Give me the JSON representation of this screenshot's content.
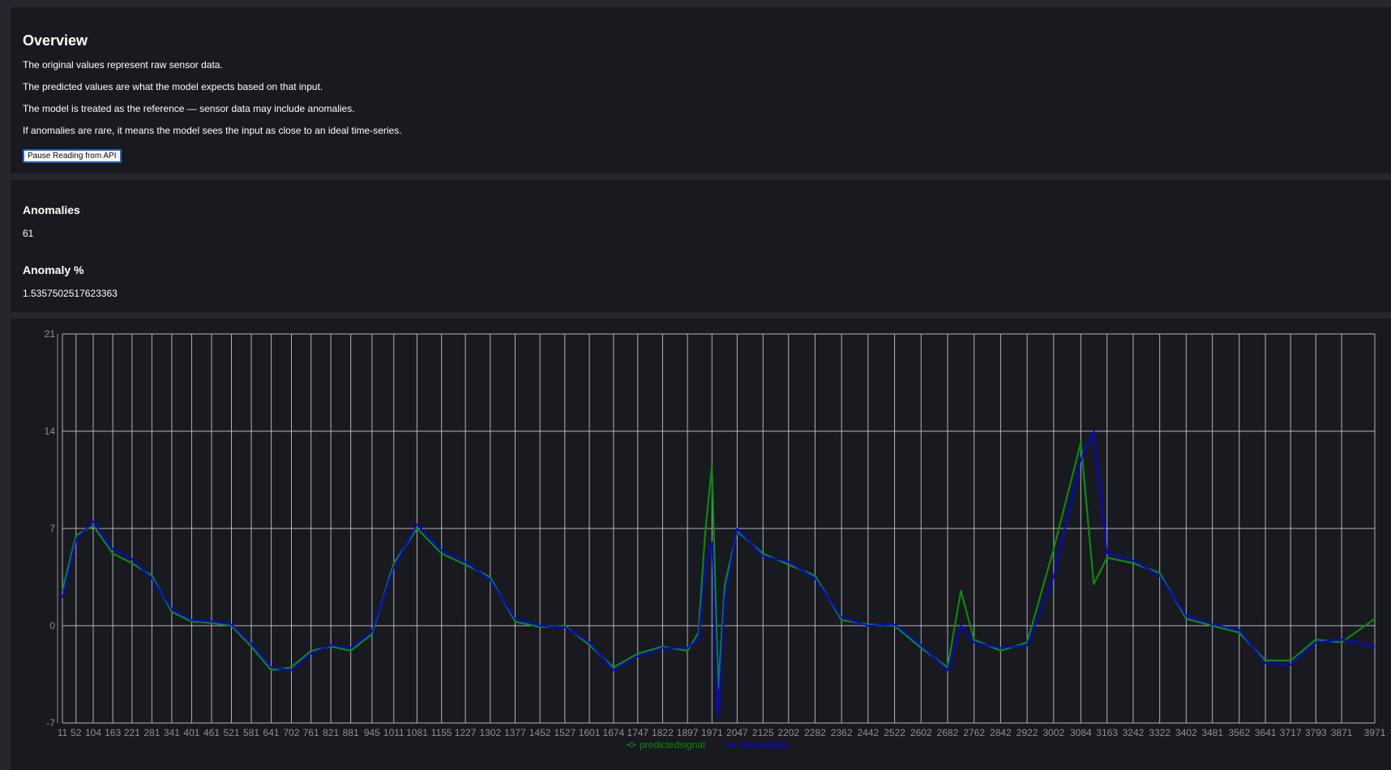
{
  "overview": {
    "title": "Overview",
    "lines": [
      "The original values represent raw sensor data.",
      "The predicted values are what the model expects based on that input.",
      "The model is treated as the reference — sensor data may include anomalies.",
      "If anomalies are rare, it means the model sees the input as close to an ideal time-series."
    ],
    "pause_button": "Pause Reading from API"
  },
  "stats": {
    "anomalies_label": "Anomalies",
    "anomalies_value": "61",
    "percent_label": "Anomaly %",
    "percent_value": "1.5357502517623363"
  },
  "colors": {
    "panel": "#181a1f",
    "background": "#25272e",
    "grid": "#ccccd2",
    "predicted": "#0c8a0c",
    "sensor": "#0000ff"
  },
  "chart_data": {
    "type": "line",
    "ylim": [
      -7,
      21
    ],
    "yticks": [
      -7,
      0,
      7,
      14,
      21
    ],
    "xlim": [
      11,
      3971
    ],
    "xticks": [
      11,
      52,
      104,
      163,
      221,
      281,
      341,
      401,
      461,
      521,
      581,
      641,
      702,
      761,
      821,
      881,
      945,
      1011,
      1081,
      1155,
      1227,
      1302,
      1377,
      1452,
      1527,
      1601,
      1674,
      1747,
      1822,
      1897,
      1971,
      2047,
      2125,
      2202,
      2282,
      2362,
      2442,
      2522,
      2602,
      2682,
      2762,
      2842,
      2922,
      3002,
      3084,
      3163,
      3242,
      3322,
      3402,
      3481,
      3562,
      3641,
      3717,
      3793,
      3871,
      3971
    ],
    "grid": true,
    "legend_position": "bottom-center",
    "series": [
      {
        "name": "predictedsignal",
        "color": "#0c8a0c",
        "points": [
          [
            11,
            2.5
          ],
          [
            52,
            6.5
          ],
          [
            104,
            7.2
          ],
          [
            163,
            5.2
          ],
          [
            221,
            4.5
          ],
          [
            281,
            3.6
          ],
          [
            341,
            1.0
          ],
          [
            401,
            0.3
          ],
          [
            461,
            0.2
          ],
          [
            521,
            0.0
          ],
          [
            581,
            -1.5
          ],
          [
            641,
            -3.2
          ],
          [
            702,
            -3.0
          ],
          [
            761,
            -1.8
          ],
          [
            821,
            -1.5
          ],
          [
            881,
            -1.8
          ],
          [
            945,
            -0.6
          ],
          [
            1011,
            4.5
          ],
          [
            1081,
            7.0
          ],
          [
            1155,
            5.2
          ],
          [
            1227,
            4.4
          ],
          [
            1302,
            3.5
          ],
          [
            1377,
            0.3
          ],
          [
            1452,
            -0.1
          ],
          [
            1527,
            0.0
          ],
          [
            1601,
            -1.4
          ],
          [
            1674,
            -3.0
          ],
          [
            1747,
            -2.0
          ],
          [
            1822,
            -1.5
          ],
          [
            1897,
            -1.8
          ],
          [
            1930,
            -0.5
          ],
          [
            1950,
            6.5
          ],
          [
            1971,
            11.5
          ],
          [
            1990,
            -4.5
          ],
          [
            2010,
            3.0
          ],
          [
            2047,
            6.8
          ],
          [
            2125,
            5.2
          ],
          [
            2202,
            4.4
          ],
          [
            2282,
            3.6
          ],
          [
            2362,
            0.4
          ],
          [
            2442,
            0.1
          ],
          [
            2522,
            0.0
          ],
          [
            2602,
            -1.6
          ],
          [
            2682,
            -3.0
          ],
          [
            2722,
            2.5
          ],
          [
            2762,
            -1.0
          ],
          [
            2842,
            -1.8
          ],
          [
            2922,
            -1.2
          ],
          [
            3002,
            5.5
          ],
          [
            3084,
            13.2
          ],
          [
            3123,
            3.0
          ],
          [
            3163,
            4.9
          ],
          [
            3242,
            4.5
          ],
          [
            3322,
            3.8
          ],
          [
            3402,
            0.5
          ],
          [
            3481,
            0.0
          ],
          [
            3562,
            -0.5
          ],
          [
            3641,
            -2.5
          ],
          [
            3717,
            -2.5
          ],
          [
            3793,
            -1.0
          ],
          [
            3871,
            -1.2
          ],
          [
            3971,
            0.5
          ]
        ]
      },
      {
        "name": "sensordata",
        "color": "#0000ff",
        "points": [
          [
            11,
            2.0
          ],
          [
            52,
            6.2
          ],
          [
            104,
            7.5
          ],
          [
            163,
            5.5
          ],
          [
            221,
            4.8
          ],
          [
            281,
            3.4
          ],
          [
            341,
            1.2
          ],
          [
            401,
            0.4
          ],
          [
            461,
            0.3
          ],
          [
            521,
            0.1
          ],
          [
            581,
            -1.3
          ],
          [
            641,
            -3.0
          ],
          [
            702,
            -3.2
          ],
          [
            761,
            -2.0
          ],
          [
            821,
            -1.4
          ],
          [
            881,
            -1.6
          ],
          [
            945,
            -0.4
          ],
          [
            1011,
            4.2
          ],
          [
            1081,
            7.3
          ],
          [
            1155,
            5.4
          ],
          [
            1227,
            4.6
          ],
          [
            1302,
            3.3
          ],
          [
            1377,
            0.5
          ],
          [
            1452,
            0.0
          ],
          [
            1527,
            -0.1
          ],
          [
            1601,
            -1.2
          ],
          [
            1674,
            -3.2
          ],
          [
            1747,
            -2.2
          ],
          [
            1822,
            -1.6
          ],
          [
            1897,
            -1.6
          ],
          [
            1930,
            -1.0
          ],
          [
            1950,
            4.0
          ],
          [
            1971,
            6.0
          ],
          [
            1990,
            -6.5
          ],
          [
            2010,
            2.0
          ],
          [
            2047,
            7.0
          ],
          [
            2125,
            5.0
          ],
          [
            2202,
            4.6
          ],
          [
            2282,
            3.4
          ],
          [
            2362,
            0.6
          ],
          [
            2442,
            0.0
          ],
          [
            2522,
            0.1
          ],
          [
            2602,
            -1.4
          ],
          [
            2682,
            -3.2
          ],
          [
            2722,
            0.0
          ],
          [
            2762,
            -1.2
          ],
          [
            2842,
            -1.6
          ],
          [
            2922,
            -1.4
          ],
          [
            3002,
            3.5
          ],
          [
            3084,
            12.0
          ],
          [
            3123,
            14.0
          ],
          [
            3163,
            5.2
          ],
          [
            3242,
            4.7
          ],
          [
            3322,
            3.6
          ],
          [
            3402,
            0.7
          ],
          [
            3481,
            0.1
          ],
          [
            3562,
            -0.3
          ],
          [
            3641,
            -2.7
          ],
          [
            3717,
            -2.8
          ],
          [
            3793,
            -1.2
          ],
          [
            3871,
            -1.0
          ],
          [
            3971,
            -1.5
          ]
        ]
      }
    ]
  }
}
